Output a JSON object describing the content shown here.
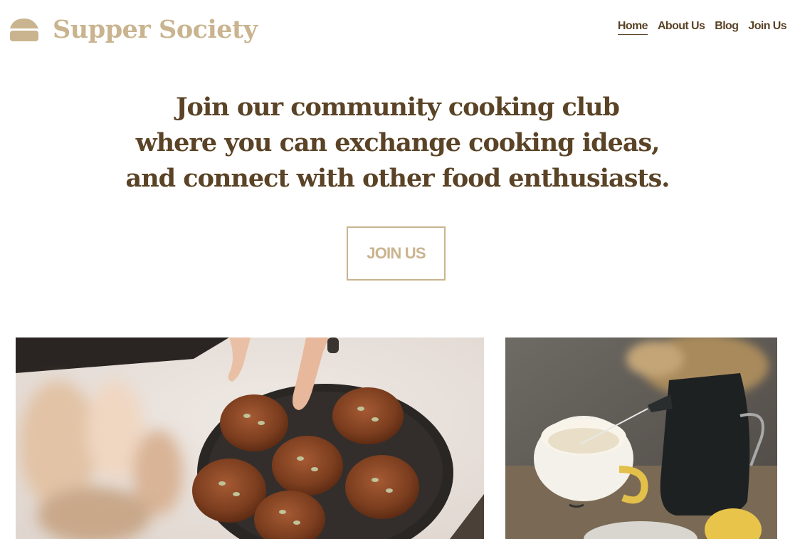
{
  "header": {
    "brand": "Supper Society",
    "logo_icon": "cake-slice-icon",
    "nav": [
      {
        "label": "Home",
        "active": true
      },
      {
        "label": "About Us",
        "active": false
      },
      {
        "label": "Blog",
        "active": false
      },
      {
        "label": "Join Us",
        "active": false
      }
    ]
  },
  "hero": {
    "lines": [
      "Join our community cooking club",
      "where you can exchange cooking ideas,",
      "and connect with other food enthusiasts."
    ],
    "cta_label": "JOIN US"
  },
  "gallery": [
    {
      "subject": "muffins-photo"
    },
    {
      "subject": "tea-pouring-photo"
    }
  ],
  "colors": {
    "accent": "#c9b48f",
    "text": "#5a4326",
    "background": "#ffffff"
  }
}
